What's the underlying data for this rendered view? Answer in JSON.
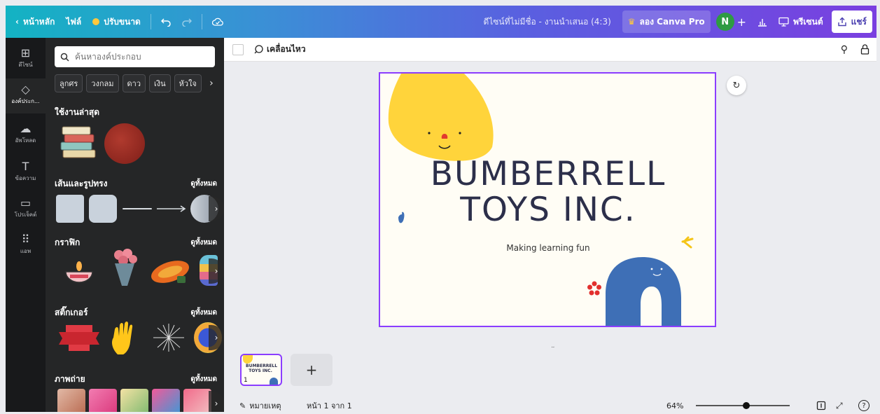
{
  "topbar": {
    "home": "หน้าหลัก",
    "file": "ไฟล์",
    "resize": "ปรับขนาด",
    "undo_icon": "undo-icon",
    "redo_icon": "redo-icon",
    "cloud_icon": "cloud-check-icon",
    "doc_title": "ดีไซน์ที่ไม่มีชื่อ - งานนำเสนอ (4:3)",
    "try_pro": "ลอง Canva Pro",
    "avatar_initial": "N",
    "present": "พรีเซนต์",
    "share": "แชร์"
  },
  "rail": {
    "items": [
      {
        "label": "ดีไซน์",
        "icon": "template-icon"
      },
      {
        "label": "องค์ประก...",
        "icon": "elements-icon"
      },
      {
        "label": "อัพโหลด",
        "icon": "upload-icon"
      },
      {
        "label": "ข้อความ",
        "icon": "text-icon"
      },
      {
        "label": "โปรเจ็คต์",
        "icon": "folder-icon"
      },
      {
        "label": "แอพ",
        "icon": "apps-icon"
      }
    ]
  },
  "panel": {
    "search_placeholder": "ค้นหาองค์ประกอบ",
    "chips": [
      "ลูกศร",
      "วงกลม",
      "ดาว",
      "เงิน",
      "หัวใจ"
    ],
    "recent_title": "ใช้งานล่าสุด",
    "lines_title": "เส้นและรูปทรง",
    "graphics_title": "กราฟิก",
    "stickers_title": "สติ๊กเกอร์",
    "photos_title": "ภาพถ่าย",
    "see_all": "ดูทั้งหมด"
  },
  "editor": {
    "animate": "เคลื่อนไหว",
    "slide_title_line1": "BUMBERRELL",
    "slide_title_line2": "TOYS INC.",
    "slide_subtitle": "Making learning fun",
    "page_number": "1"
  },
  "footer": {
    "notes": "หมายเหตุ",
    "page_info": "หน้า 1 จาก 1",
    "zoom": "64%",
    "zoom_fraction": 0.54
  },
  "colors": {
    "accent": "#8b3dff",
    "slide_bg": "#fffdf5",
    "yellow": "#ffd43b",
    "blue": "#3e6fb6"
  }
}
